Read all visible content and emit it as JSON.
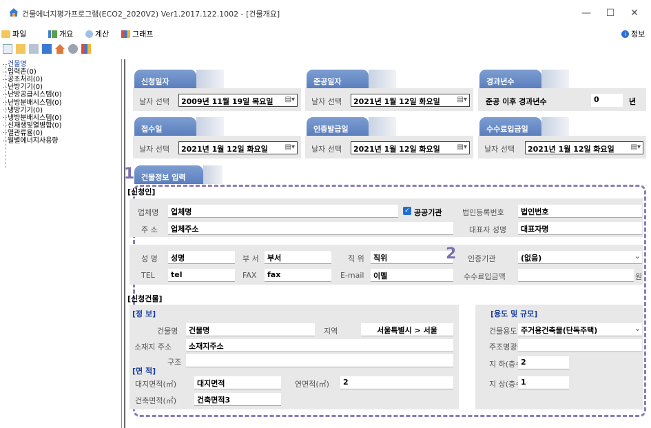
{
  "window": {
    "title": "건물에너지평가프로그램(ECO2_2020V2) Ver1.2017.122.1002 - [건물개요]",
    "min": "—",
    "max": "☐",
    "close": "✕"
  },
  "menu": {
    "file": "파일",
    "overview": "개요",
    "calc": "계산",
    "graph": "그래프",
    "info": "정보"
  },
  "tree": [
    "건물명",
    "입력존(0)",
    "공조처리(0)",
    "난방기기(0)",
    "난방공급시스템(0)",
    "난방분배시스템(0)",
    "냉방기기(0)",
    "냉방분배시스템(0)",
    "신재생및열병합(0)",
    "열관류율(0)",
    "월별에너지사용량"
  ],
  "dates": {
    "apply": {
      "tab": "신청일자",
      "label": "날자 선택",
      "value": "2009년 11월 19일 목요일"
    },
    "complete": {
      "tab": "준공일자",
      "label": "날자 선택",
      "value": "2021년  1월 12일 화요일"
    },
    "elapsed": {
      "tab": "경과년수",
      "label": "준공 이후 경과년수",
      "value": "0",
      "unit": "년"
    },
    "receipt": {
      "tab": "접수일",
      "label": "날자 선택",
      "value": "2021년  1월 12일 화요일"
    },
    "certissue": {
      "tab": "인증발급일",
      "label": "날자 선택",
      "value": "2021년  1월 12일 화요일"
    },
    "fee": {
      "tab": "수수료입금일",
      "label": "날자 선택",
      "value": "2021년  1월 12일 화요일"
    }
  },
  "building_tab": "건물정보 입력",
  "markers": {
    "one": "1",
    "two": "2"
  },
  "applicant": {
    "heading": "[신청인]",
    "company_label": "업체명",
    "company": "업체명",
    "public_label": "공공기관",
    "corp_no_label": "법인등록번호",
    "corp_no": "법인번호",
    "address_label": "주 소",
    "address": "업체주소",
    "ceo_label": "대표자 성명",
    "ceo": "대표자명",
    "name_label": "성 명",
    "name": "성명",
    "dept_label": "부 서",
    "dept": "부서",
    "pos_label": "직 위",
    "pos": "직위",
    "cert_org_label": "인증기관",
    "cert_org": "(없음)",
    "tel_label": "TEL",
    "tel": "tel",
    "fax_label": "FAX",
    "fax": "fax",
    "email_label": "E-mail",
    "email": "이멜",
    "fee_label": "수수료입금액",
    "fee": "",
    "fee_unit": "원"
  },
  "building": {
    "heading": "[신청건물]",
    "info_heading": "[정  보]",
    "name_label": "건물명",
    "name": "건물명",
    "region_label": "지역",
    "region": "서울특별시 > 서울",
    "address_label": "소재지 주소",
    "address": "소재지주소",
    "structure_label": "구조",
    "structure": "",
    "area_heading": "[면  적]",
    "site_label": "대지면적(㎡)",
    "site": "대지면적",
    "floor_label": "연면적(㎡)",
    "floor": "2",
    "bldg_label": "건축면적(㎡)",
    "bldg": "건축면적3",
    "use_heading": "[용도 및 규모]",
    "use_label": "건물용도",
    "use": "주거용건축물(단독주택)",
    "main_label": "주조명광원",
    "main": "",
    "below_label": "지 하(층수)",
    "below": "2",
    "above_label": "지 상(층수)",
    "above": "1"
  }
}
